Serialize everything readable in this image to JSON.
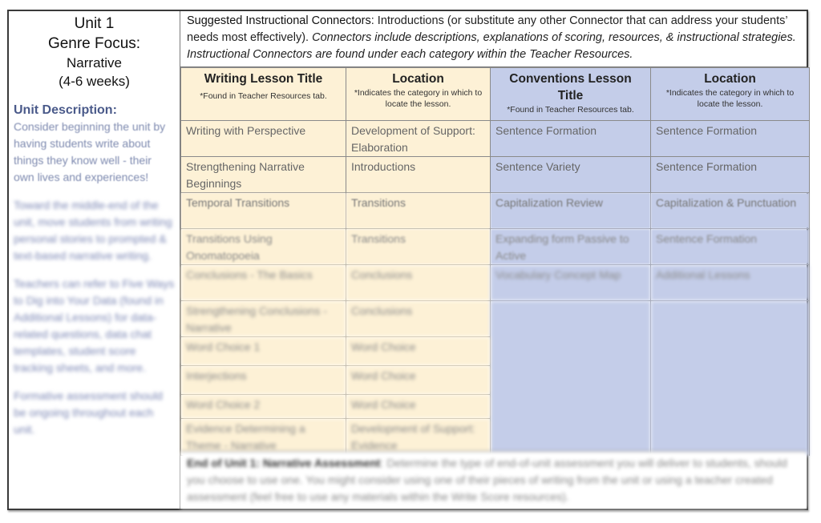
{
  "unit": {
    "title": "Unit 1",
    "genre_label": "Genre Focus:",
    "genre": "Narrative",
    "duration": "(4-6 weeks)",
    "description_label": "Unit Description:",
    "description_paragraphs": [
      "Consider beginning the unit by having students write about things they know well - their own lives and experiences!",
      "Toward the middle-end of the unit, move students from writing personal stories to prompted & text-based narrative writing.",
      "Teachers can refer to Five Ways to Dig into Your Data (found in Additional Lessons) for data-related questions, data chat templates, student score tracking sheets, and more.",
      "Formative assessment should be ongoing throughout each unit."
    ]
  },
  "connectors": {
    "label": "Suggested Instructional Connectors",
    "text": ": Introductions (or substitute any other Connector that can address your students’ needs most effectively). ",
    "italic": "Connectors include descriptions, explanations of scoring, resources, & instructional strategies. Instructional Connectors are found under each category within the Teacher Resources."
  },
  "table": {
    "headers": [
      {
        "title": "Writing Lesson Title",
        "note": "*Found in Teacher Resources tab."
      },
      {
        "title": "Location",
        "note": "*Indicates the category in which to locate the lesson."
      },
      {
        "title": "Conventions Lesson Title",
        "note": "*Found in Teacher Resources tab."
      },
      {
        "title": "Location",
        "note": "*Indicates the category in which to locate the lesson."
      }
    ],
    "writing_rows": [
      {
        "title": "Writing with Perspective",
        "location": "Development of Support: Elaboration"
      },
      {
        "title": "Strengthening Narrative Beginnings",
        "location": "Introductions"
      },
      {
        "title": "Temporal Transitions",
        "location": "Transitions"
      },
      {
        "title": "Transitions Using Onomatopoeia",
        "location": "Transitions"
      },
      {
        "title": "Conclusions - The Basics",
        "location": "Conclusions"
      },
      {
        "title": "Strengthening Conclusions - Narrative",
        "location": "Conclusions"
      },
      {
        "title": "Word Choice 1",
        "location": "Word Choice"
      },
      {
        "title": "Interjections",
        "location": "Word Choice"
      },
      {
        "title": "Word Choice 2",
        "location": "Word Choice"
      },
      {
        "title": "Evidence Determining a Theme - Narrative",
        "location": "Development of Support: Evidence"
      }
    ],
    "conventions_rows": [
      {
        "title": "Sentence Formation",
        "location": "Sentence Formation"
      },
      {
        "title": "Sentence Variety",
        "location": "Sentence Formation"
      },
      {
        "title": "Capitalization Review",
        "location": "Capitalization & Punctuation"
      },
      {
        "title": "Expanding form Passive to Active",
        "location": "Sentence Formation"
      },
      {
        "title": "Vocabulary Concept Map",
        "location": "Additional Lessons"
      }
    ]
  },
  "assessment": {
    "label": "End of Unit 1: Narrative Assessment",
    "text": ": Determine the type of end-of-unit assessment you will deliver to students, should you choose to use one. You might consider using one of their pieces of writing from the unit or using a teacher created assessment (feel free to use any materials within the Write Score resources)."
  }
}
